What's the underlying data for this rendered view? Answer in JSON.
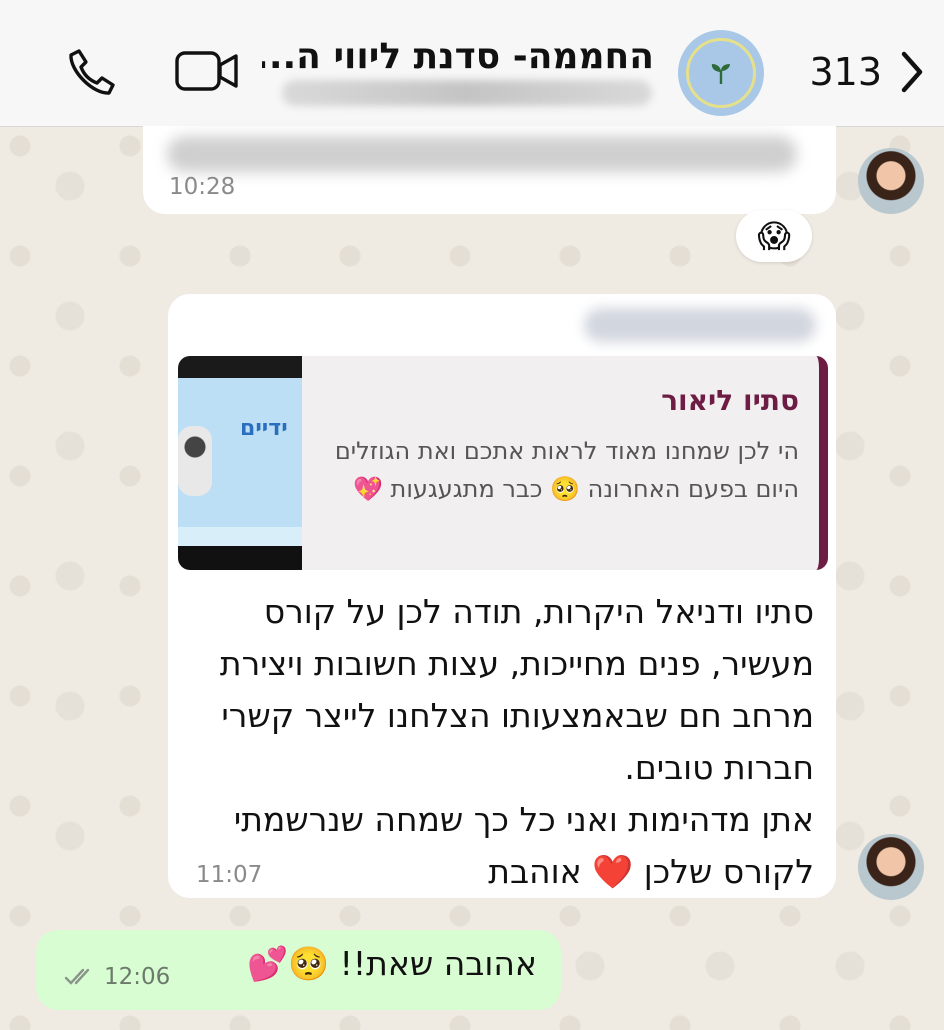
{
  "header": {
    "back_count": "313",
    "title": "החממה- סדנת ליווי ה..."
  },
  "messages": {
    "first": {
      "time": "10:28",
      "reaction": "😱"
    },
    "second": {
      "quote": {
        "thumb_text": "ידיים",
        "sender": "סתיו ליאור",
        "text": "הי לכן שמחנו מאוד לראות אתכם ואת הגוזלים היום בפעם האחרונה 🥺 כבר מתגעגעות 💖"
      },
      "text_line1": "סתיו ודניאל היקרות, תודה לכן על קורס מעשיר, פנים מחייכות, עצות חשובות ויצירת מרחב חם שבאמצעותו הצלחנו לייצר קשרי חברות טובים.",
      "text_line2": "אתן מדהימות ואני כל כך שמחה שנרשמתי לקורס שלכן ❤️ אוהבת",
      "time": "11:07"
    },
    "third": {
      "text": "אהובה שאת!! 🥺💕",
      "time": "12:06"
    }
  },
  "colors": {
    "outgoing_bubble": "#d9fdd3",
    "quote_accent": "#6d1d44",
    "wallpaper": "#efeae2"
  },
  "icons": [
    "chevron-left-icon",
    "phone-icon",
    "video-icon",
    "sprout-icon",
    "double-check-icon"
  ]
}
